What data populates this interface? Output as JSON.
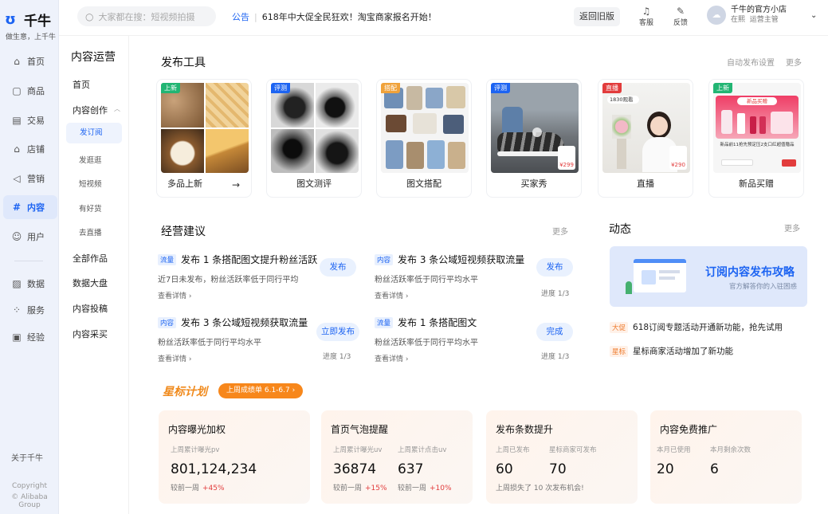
{
  "brand": {
    "name": "千牛",
    "slogan": "做生意，上千牛"
  },
  "rail": {
    "items": [
      {
        "label": "首页",
        "icon": "home-icon"
      },
      {
        "label": "商品",
        "icon": "goods-icon"
      },
      {
        "label": "交易",
        "icon": "trade-icon"
      },
      {
        "label": "店铺",
        "icon": "shop-icon"
      },
      {
        "label": "营销",
        "icon": "marketing-icon"
      },
      {
        "label": "内容",
        "icon": "content-icon"
      },
      {
        "label": "用户",
        "icon": "user-icon"
      },
      {
        "label": "数据",
        "icon": "data-icon"
      },
      {
        "label": "服务",
        "icon": "service-icon"
      },
      {
        "label": "经验",
        "icon": "experience-icon"
      }
    ],
    "about": "关于千牛",
    "copyright_1": "Copyright",
    "copyright_2": "© Alibaba Group"
  },
  "topbar": {
    "search_placeholder": "大家都在搜：短视频拍摄",
    "notice_tag": "公告",
    "notice_text": "618年中大促全民狂欢！淘宝商家报名开始！",
    "old_version": "返回旧版",
    "service": "客服",
    "feedback": "反馈",
    "shop_name": "千牛的官方小店",
    "user_status": "在熙",
    "user_role": "运营主管"
  },
  "side": {
    "title": "内容运营",
    "home": "首页",
    "create": "内容创作",
    "subs": [
      "发订阅",
      "发逛逛",
      "短视频",
      "有好货",
      "去直播"
    ],
    "works": "全部作品",
    "dashboard": "数据大盘",
    "submit": "内容投稿",
    "collect": "内容采买"
  },
  "publish": {
    "title": "发布工具",
    "auto": "自动发布设置",
    "more": "更多",
    "cards": [
      {
        "label": "多品上新",
        "badge": "上新"
      },
      {
        "label": "图文测评",
        "badge": "评测"
      },
      {
        "label": "图文搭配",
        "badge": "搭配"
      },
      {
        "label": "买家秀",
        "badge": "评测",
        "price": "¥299"
      },
      {
        "label": "直播",
        "badge": "直播",
        "viewers": "1830观看",
        "price": "¥290"
      },
      {
        "label": "新品买赠",
        "badge": "上新",
        "promo": "新品买赠",
        "promo_text": "新品前11抢先预定压2支口红超值赠品"
      }
    ]
  },
  "advice": {
    "title": "经营建议",
    "more": "更多",
    "items": [
      {
        "tag": "流量",
        "title": "发布 1 条搭配图文提升粉丝活跃",
        "desc": "近7日未发布，粉丝活跃率低于同行平均",
        "detail": "查看详情",
        "btn": "发布"
      },
      {
        "tag": "内容",
        "title": "发布 3 条公域短视频获取流量",
        "desc": "粉丝活跃率低于同行平均水平",
        "detail": "查看详情",
        "btn": "发布",
        "progress": "进度 1/3"
      },
      {
        "tag": "内容",
        "title": "发布 3 条公域短视频获取流量",
        "desc": "粉丝活跃率低于同行平均水平",
        "detail": "查看详情",
        "btn": "立即发布",
        "progress": "进度 1/3"
      },
      {
        "tag": "流量",
        "title": "发布 1 条搭配图文",
        "desc": "粉丝活跃率低于同行平均水平",
        "detail": "查看详情",
        "btn": "完成",
        "progress": "进度 1/3"
      }
    ]
  },
  "news": {
    "title": "动态",
    "more": "更多",
    "banner_title": "订阅内容发布攻略",
    "banner_sub": "官方解答你的入驻困惑",
    "items": [
      {
        "tag": "大促",
        "text": "618订阅专题活动开通新功能，抢先试用"
      },
      {
        "tag": "星标",
        "text": "星标商家活动增加了新功能"
      }
    ]
  },
  "star": {
    "logo": "星标计划",
    "pill": "上周成绩单 6.1-6.7 ›",
    "cards": [
      {
        "title": "内容曝光加权",
        "l1": "上周累计曝光pv",
        "v1": "801,124,234",
        "cmp": "较前一周",
        "d1": "+45%"
      },
      {
        "title": "首页气泡提醒",
        "l1": "上周累计曝光uv",
        "v1": "36874",
        "cmp": "较前一周",
        "d1": "+15%",
        "l2": "上周累计点击uv",
        "v2": "637",
        "d2": "+10%"
      },
      {
        "title": "发布条数提升",
        "l1": "上周已发布",
        "v1": "60",
        "l2": "星标商家可发布",
        "v2": "70",
        "note": "上周损失了 10 次发布机会!"
      },
      {
        "title": "内容免费推广",
        "l1": "本月已使用",
        "v1": "20",
        "l2": "本月剩余次数",
        "v2": "6"
      }
    ]
  },
  "colors": {
    "accent": "#1d64f2",
    "orange": "#f7871b",
    "green": "#22b573",
    "red": "#e23c3c"
  }
}
